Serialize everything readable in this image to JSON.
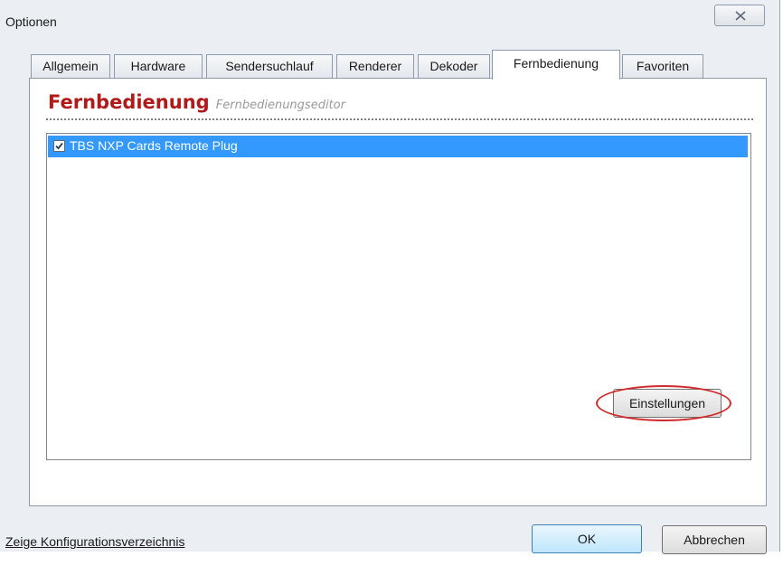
{
  "window": {
    "title": "Optionen",
    "close_icon": "close-icon"
  },
  "tabs": [
    {
      "label": "Allgemein",
      "active": false
    },
    {
      "label": "Hardware",
      "active": false
    },
    {
      "label": "Sendersuchlauf",
      "active": false
    },
    {
      "label": "Renderer",
      "active": false
    },
    {
      "label": "Dekoder",
      "active": false
    },
    {
      "label": "Fernbedienung",
      "active": true
    },
    {
      "label": "Favoriten",
      "active": false
    }
  ],
  "panel": {
    "heading": "Fernbedienung",
    "subheading": "Fernbedienungseditor",
    "plugins": [
      {
        "label": "TBS NXP Cards Remote Plug",
        "checked": true,
        "selected": true
      }
    ],
    "settings_button": "Einstellungen"
  },
  "footer": {
    "config_link": "Zeige Konfigurationsverzeichnis",
    "ok_button": "OK",
    "cancel_button": "Abbrechen"
  },
  "colors": {
    "heading": "#b21a1a",
    "selection": "#3399ff",
    "highlight_ring": "#d12a2a",
    "window_bg": "#ebeff4"
  }
}
